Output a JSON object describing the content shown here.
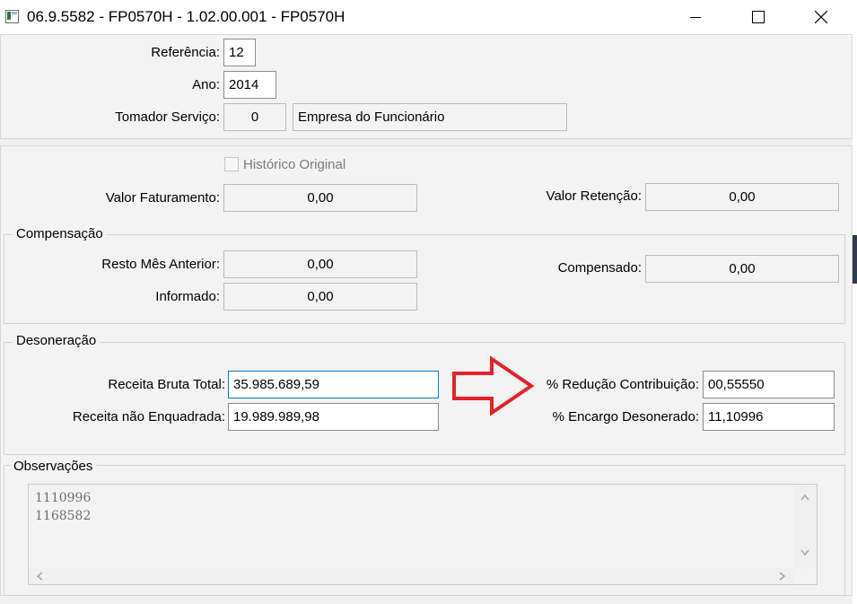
{
  "window": {
    "title": "06.9.5582 - FP0570H - 1.02.00.001 - FP0570H",
    "icons": {
      "minimize": "minimize-icon",
      "maximize": "maximize-icon",
      "close": "close-icon"
    }
  },
  "header": {
    "referencia_label": "Referência:",
    "referencia_value": "12",
    "ano_label": "Ano:",
    "ano_value": "2014",
    "tomador_label": "Tomador Serviço:",
    "tomador_code": "0",
    "tomador_name": "Empresa do Funcionário"
  },
  "valores": {
    "historico_label": "Histórico Original",
    "historico_checked": false,
    "faturamento_label": "Valor Faturamento:",
    "faturamento_value": "0,00",
    "retencao_label": "Valor Retenção:",
    "retencao_value": "0,00"
  },
  "compensacao": {
    "title": "Compensação",
    "resto_label": "Resto Mês Anterior:",
    "resto_value": "0,00",
    "informado_label": "Informado:",
    "informado_value": "0,00",
    "compensado_label": "Compensado:",
    "compensado_value": "0,00"
  },
  "desoneracao": {
    "title": "Desoneração",
    "receita_bruta_label": "Receita Bruta Total:",
    "receita_bruta_value": "35.985.689,59",
    "receita_nao_label": "Receita não Enquadrada:",
    "receita_nao_value": "19.989.989,98",
    "reducao_label": "% Redução Contribuição:",
    "reducao_value": "00,55550",
    "encargo_label": "% Encargo Desonerado:",
    "encargo_value": "11,10996"
  },
  "observacoes": {
    "title": "Observações",
    "lines": [
      "1110996",
      "1168582"
    ]
  },
  "colors": {
    "annotation_arrow": "#e8202a",
    "focus_border": "#0078d7"
  }
}
